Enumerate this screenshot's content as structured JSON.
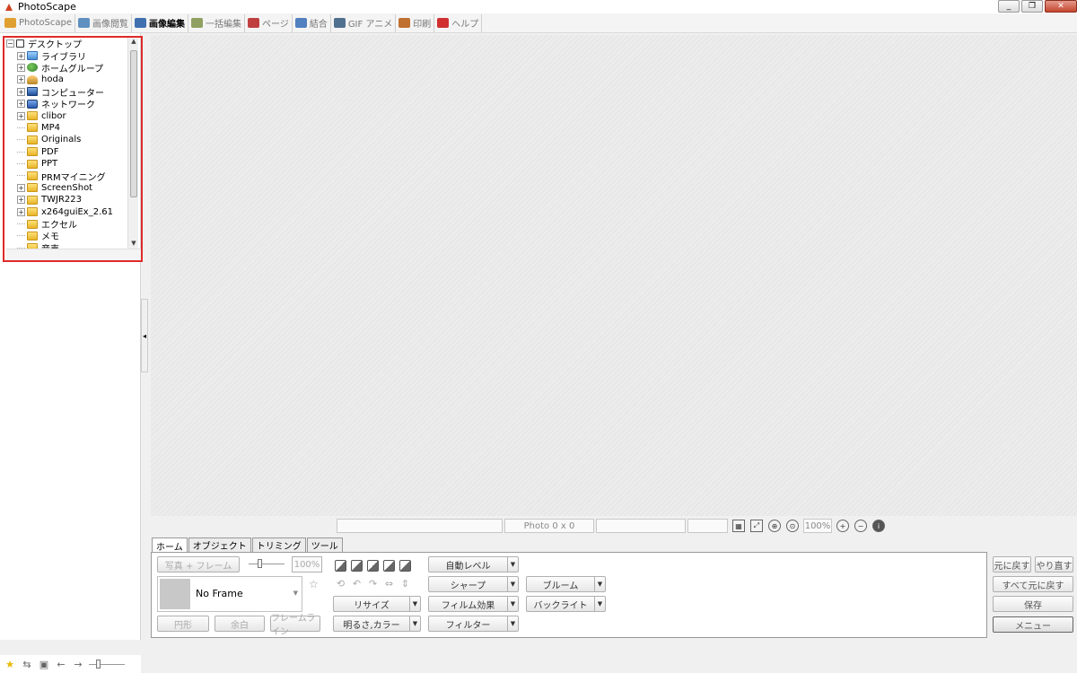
{
  "window": {
    "title": "PhotoScape",
    "min": "_",
    "max": "❐",
    "close": "✕"
  },
  "tabs": [
    {
      "label": "PhotoScape",
      "color": "#e0a030"
    },
    {
      "label": "画像閲覧",
      "color": "#6090c0"
    },
    {
      "label": "画像編集",
      "color": "#4070b0",
      "active": true
    },
    {
      "label": "一括編集",
      "color": "#90a060"
    },
    {
      "label": "ページ",
      "color": "#c04040"
    },
    {
      "label": "結合",
      "color": "#5080c0"
    },
    {
      "label": "GIF アニメ",
      "color": "#507090"
    },
    {
      "label": "印刷",
      "color": "#c07030"
    },
    {
      "label": "ヘルプ",
      "color": "#d03030"
    }
  ],
  "tree": {
    "root": "デスクトップ",
    "items": [
      {
        "label": "ライブラリ",
        "icon": "library-icon",
        "expandable": true
      },
      {
        "label": "ホームグループ",
        "icon": "homegroup-icon",
        "expandable": true
      },
      {
        "label": "hoda",
        "icon": "user-icon",
        "expandable": true
      },
      {
        "label": "コンピューター",
        "icon": "computer-icon",
        "expandable": true
      },
      {
        "label": "ネットワーク",
        "icon": "network-icon",
        "expandable": true
      },
      {
        "label": "clibor",
        "icon": "folder-icon",
        "expandable": true
      },
      {
        "label": "MP4",
        "icon": "folder-icon",
        "expandable": false
      },
      {
        "label": "Originals",
        "icon": "folder-icon",
        "expandable": false
      },
      {
        "label": "PDF",
        "icon": "folder-icon",
        "expandable": false
      },
      {
        "label": "PPT",
        "icon": "folder-icon",
        "expandable": false
      },
      {
        "label": "PRMマイニング",
        "icon": "folder-icon",
        "expandable": false
      },
      {
        "label": "ScreenShot",
        "icon": "folder-icon",
        "expandable": true
      },
      {
        "label": "TWJR223",
        "icon": "folder-icon",
        "expandable": true
      },
      {
        "label": "x264guiEx_2.61",
        "icon": "folder-icon",
        "expandable": true
      },
      {
        "label": "エクセル",
        "icon": "folder-icon",
        "expandable": false
      },
      {
        "label": "メモ",
        "icon": "folder-icon",
        "expandable": false
      },
      {
        "label": "音声",
        "icon": "folder-icon",
        "expandable": false
      }
    ]
  },
  "status": {
    "photo": "Photo 0 x 0",
    "zoom": "100%"
  },
  "edit_tabs": [
    "ホーム",
    "オブジェクト",
    "トリミング",
    "ツール"
  ],
  "home": {
    "photo_frame": "写真 + フレーム",
    "frame_percent": "100%",
    "frame_name": "No Frame",
    "circle": "円形",
    "margin": "余白",
    "frame_line": "フレームライン",
    "resize": "リサイズ",
    "brightness": "明るさ,カラー",
    "auto_level": "自動レベル",
    "sharp": "シャープ",
    "film_effect": "フィルム効果",
    "filter": "フィルター",
    "bloom": "ブルーム",
    "backlight": "バックライト"
  },
  "right": {
    "undo": "元に戻す",
    "redo": "やり直す",
    "undo_all": "すべて元に戻す",
    "save": "保存",
    "menu": "メニュー"
  }
}
